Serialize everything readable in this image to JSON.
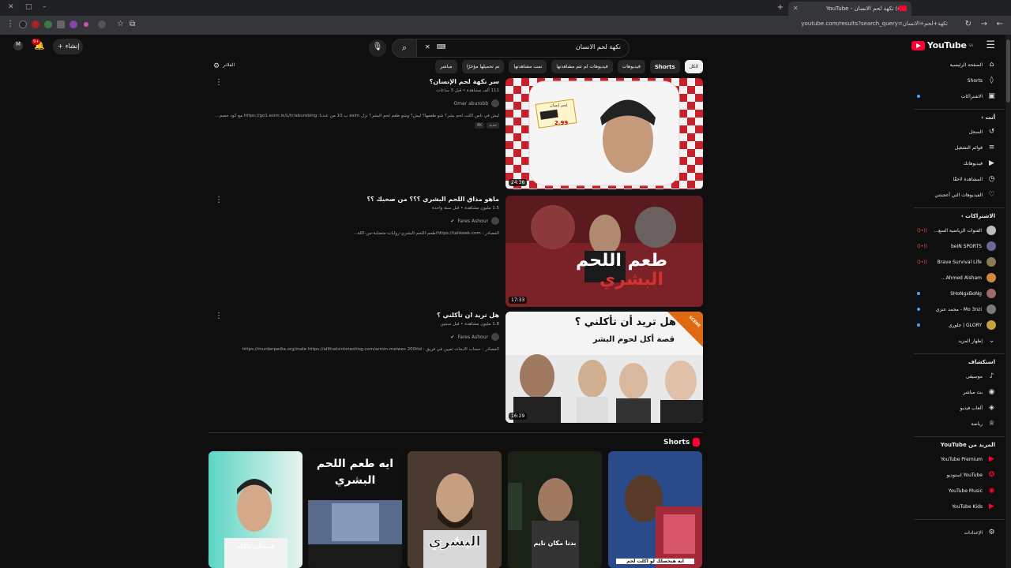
{
  "browser": {
    "tab_title": "(48) تكهة لحم الانسان - YouTube",
    "new_tab": "+",
    "url": "youtube.com/results?search_query=تكهة+لحم+الانسان",
    "min": "–",
    "max": "□",
    "close": "✕"
  },
  "masthead": {
    "logo": "YouTube",
    "logo_sup": "SA",
    "search_value": "نكهة لحم الانسان",
    "create_label": "إنشاء",
    "notif_count": "9+"
  },
  "chips": [
    "الكل",
    "Shorts",
    "فيديوهات",
    "فيديوهات لم تتم مشاهدتها",
    "تمت مشاهدتها",
    "تم تحميلها مؤخرًا",
    "مباشر"
  ],
  "filter_label": "الفلاتر",
  "results": [
    {
      "title": "سر نكهة لحم الإنسان؟",
      "meta": "111 ألف مشاهدة • قبل 3 ساعات",
      "channel": "Omar aburobb",
      "desc": "ليش في ناس اكلت لحم بشر؟ شو طعمها؟ ليش؟ وشو طعم لحم البشر؟ نزل esim ب 10 من عندنا: https://go1.esim.io/L/tr/aburobing مع كود خصم...",
      "badges": [
        "4K",
        "جديد"
      ],
      "duration": "24:36"
    },
    {
      "title": "ماهو مذاق اللحم البشري ؟؟؟ من صحبك ؟؟",
      "meta": "1.5 مليون مشاهدة • قبل سنة واحدة",
      "channel": "Fares Ashour",
      "desc": "المصادر : https://tahkeek.com/طعم-اللحم-البشري-روايات-متصلبة-من-اكلة...",
      "badges": [],
      "duration": "17:33"
    },
    {
      "title": "هل تريد ان تأكلني ؟",
      "meta": "1.8 مليون مشاهدة • قبل سنتين",
      "channel": "Fares Ashour",
      "desc": "المصادر : حساب الابحاث تعيين في فريق : https://murderpedia.org/male https://allthatsinteresting.com/armin-meiwes 200ttd",
      "badges": [],
      "duration": "16:29"
    }
  ],
  "thumbs": {
    "t1_price": "2.99",
    "t1_label": "لحم انسان",
    "t2_text1": "طعم اللحم",
    "t2_text2": "البشري",
    "t3_line1": "هل تريد أن تأكلني ؟",
    "t3_line2": "قصة أكل لحوم البشر",
    "t3_corner": "SCENE"
  },
  "shorts": {
    "heading": "Shorts",
    "items": [
      {
        "caption": "فستان ناكله"
      },
      {
        "caption": "ايه طعم اللحم البشري"
      },
      {
        "caption": "البشري"
      },
      {
        "caption": "بدنا مكان نايم"
      },
      {
        "caption": "ايه هيحصلك لو اكلت لحم"
      }
    ]
  },
  "sidebar": {
    "main": [
      {
        "label": "الصفحة الرئيسية",
        "icon": "⌂"
      },
      {
        "label": "Shorts",
        "icon": "◊"
      },
      {
        "label": "الاشتراكات",
        "icon": "▣"
      }
    ],
    "you_head": "أنت",
    "you": [
      {
        "label": "السجل",
        "icon": "↺"
      },
      {
        "label": "قوائم التشغيل",
        "icon": "≡"
      },
      {
        "label": "فيديوهاتك",
        "icon": "▶"
      },
      {
        "label": "المشاهدة لاحقًا",
        "icon": "◷"
      },
      {
        "label": "الفيديوهات التي أعجبتني",
        "icon": "♡"
      }
    ],
    "subs_head": "الاشتراكات",
    "subs": [
      {
        "label": "القنوات الرياضية السع...",
        "color": "#bbbbbb"
      },
      {
        "label": "beIN SPORTS",
        "color": "#6a6a9a"
      },
      {
        "label": "Brave Survival Life",
        "color": "#8a7a5a"
      },
      {
        "label": "Ahmed Alsham...",
        "color": "#d08a40"
      },
      {
        "label": "SHoNgxBoNg",
        "color": "#a06a6a"
      },
      {
        "label": "Mo 3nzi - محمد عنزي",
        "color": "#7a7a7a"
      },
      {
        "label": "GLORY | جلوري",
        "color": "#c8a040"
      }
    ],
    "show_more": "إظهار المزيد",
    "explore_head": "استكشاف",
    "explore": [
      {
        "label": "موسيقى",
        "icon": "♪"
      },
      {
        "label": "بث مباشر",
        "icon": "◉"
      },
      {
        "label": "ألعاب فيديو",
        "icon": "◈"
      },
      {
        "label": "رياضة",
        "icon": "♕"
      }
    ],
    "more_head": "المزيد من YouTube",
    "more": [
      {
        "label": "YouTube Premium"
      },
      {
        "label": "YouTube استوديو"
      },
      {
        "label": "YouTube Music"
      },
      {
        "label": "YouTube Kids"
      }
    ],
    "settings": "الإعدادات"
  }
}
